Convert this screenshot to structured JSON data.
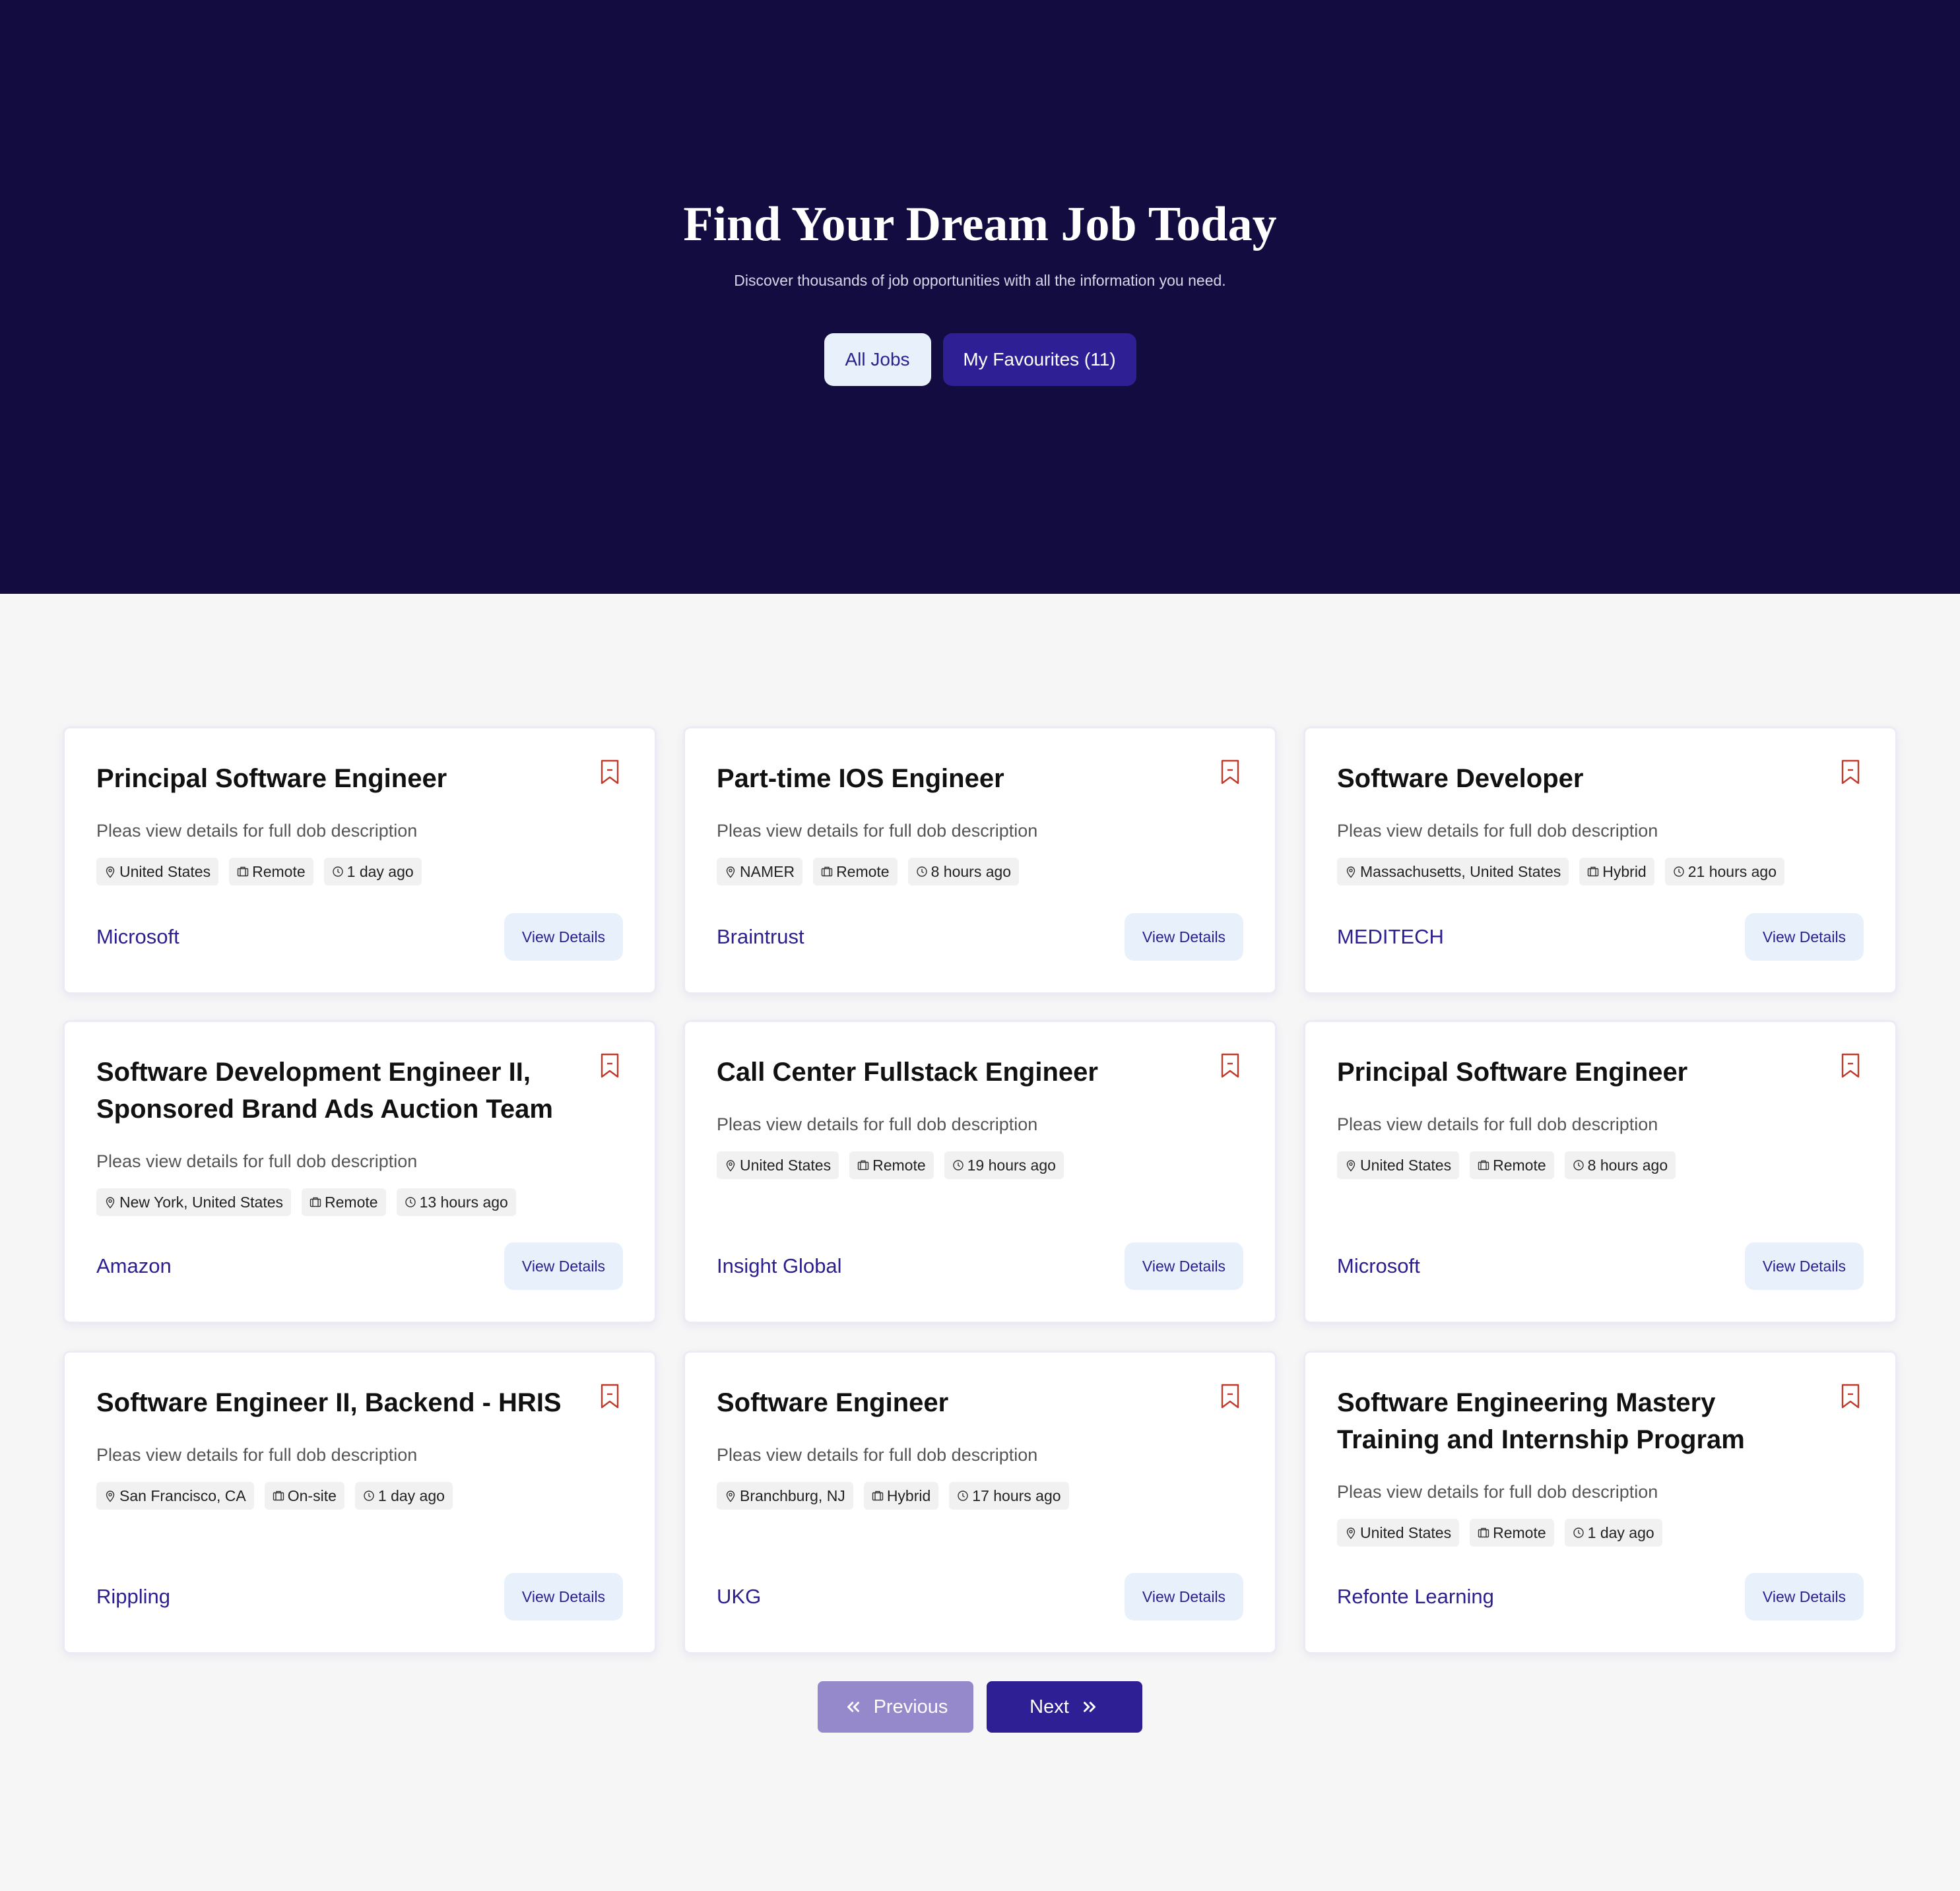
{
  "hero": {
    "title": "Find Your Dream Job Today",
    "subtitle": "Discover thousands of job opportunities with all the information you need.",
    "tab_all": "All Jobs",
    "tab_favourites": "My Favourites (11)"
  },
  "view_label": "View Details",
  "jobs": [
    {
      "title": "Principal Software Engineer",
      "description": "Pleas view details for full dob description",
      "location": "United States",
      "type": "Remote",
      "posted": "1 day ago",
      "company": "Microsoft"
    },
    {
      "title": "Part-time IOS Engineer",
      "description": "Pleas view details for full dob description",
      "location": "NAMER",
      "type": "Remote",
      "posted": "8 hours ago",
      "company": "Braintrust"
    },
    {
      "title": "Software Developer",
      "description": "Pleas view details for full dob description",
      "location": "Massachusetts, United States",
      "type": "Hybrid",
      "posted": "21 hours ago",
      "company": "MEDITECH"
    },
    {
      "title": "Software Development Engineer II, Sponsored Brand Ads Auction Team",
      "description": "Pleas view details for full dob description",
      "location": "New York, United States",
      "type": "Remote",
      "posted": "13 hours ago",
      "company": "Amazon"
    },
    {
      "title": "Call Center Fullstack Engineer",
      "description": "Pleas view details for full dob description",
      "location": "United States",
      "type": "Remote",
      "posted": "19 hours ago",
      "company": "Insight Global"
    },
    {
      "title": "Principal Software Engineer",
      "description": "Pleas view details for full dob description",
      "location": "United States",
      "type": "Remote",
      "posted": "8 hours ago",
      "company": "Microsoft"
    },
    {
      "title": "Software Engineer II, Backend - HRIS",
      "description": "Pleas view details for full dob description",
      "location": "San Francisco, CA",
      "type": "On-site",
      "posted": "1 day ago",
      "company": "Rippling"
    },
    {
      "title": "Software Engineer",
      "description": "Pleas view details for full dob description",
      "location": "Branchburg, NJ",
      "type": "Hybrid",
      "posted": "17 hours ago",
      "company": "UKG"
    },
    {
      "title": "Software Engineering Mastery Training and Internship Program",
      "description": "Pleas view details for full dob description",
      "location": "United States",
      "type": "Remote",
      "posted": "1 day ago",
      "company": "Refonte Learning"
    }
  ],
  "pagination": {
    "previous": "Previous",
    "next": "Next"
  },
  "colors": {
    "hero_bg": "#130c40",
    "accent": "#2e1f94",
    "bookmark": "#c0392b"
  }
}
